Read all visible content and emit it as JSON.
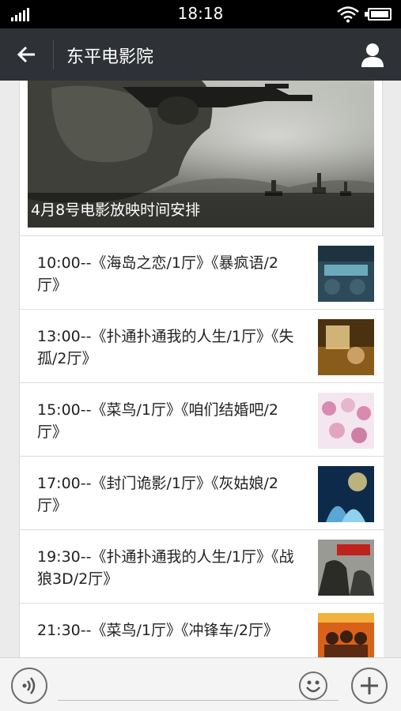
{
  "status_bar": {
    "time": "18:18"
  },
  "nav": {
    "title": "东平电影院"
  },
  "article": {
    "caption": "4月8号电影放映时间安排",
    "items": [
      {
        "text": "10:00--《海岛之恋/1厅》《暴疯语/2厅》"
      },
      {
        "text": "13:00--《扑通扑通我的人生/1厅》《失孤/2厅》"
      },
      {
        "text": "15:00--《菜鸟/1厅》《咱们结婚吧/2厅》"
      },
      {
        "text": "17:00--《封门诡影/1厅》《灰姑娘/2厅》"
      },
      {
        "text": "19:30--《扑通扑通我的人生/1厅》《战狼3D/2厅》"
      },
      {
        "text": "21:30--《菜鸟/1厅》《冲锋车/2厅》"
      }
    ]
  },
  "input": {
    "value": ""
  },
  "colors": {
    "nav_bg": "#2e3136",
    "status_bg": "#000000",
    "page_bg": "#ebebeb"
  },
  "icons": {
    "back": "arrow-left-icon",
    "profile": "person-icon",
    "voice": "voice-icon",
    "emoji": "smiley-icon",
    "plus": "plus-icon"
  }
}
